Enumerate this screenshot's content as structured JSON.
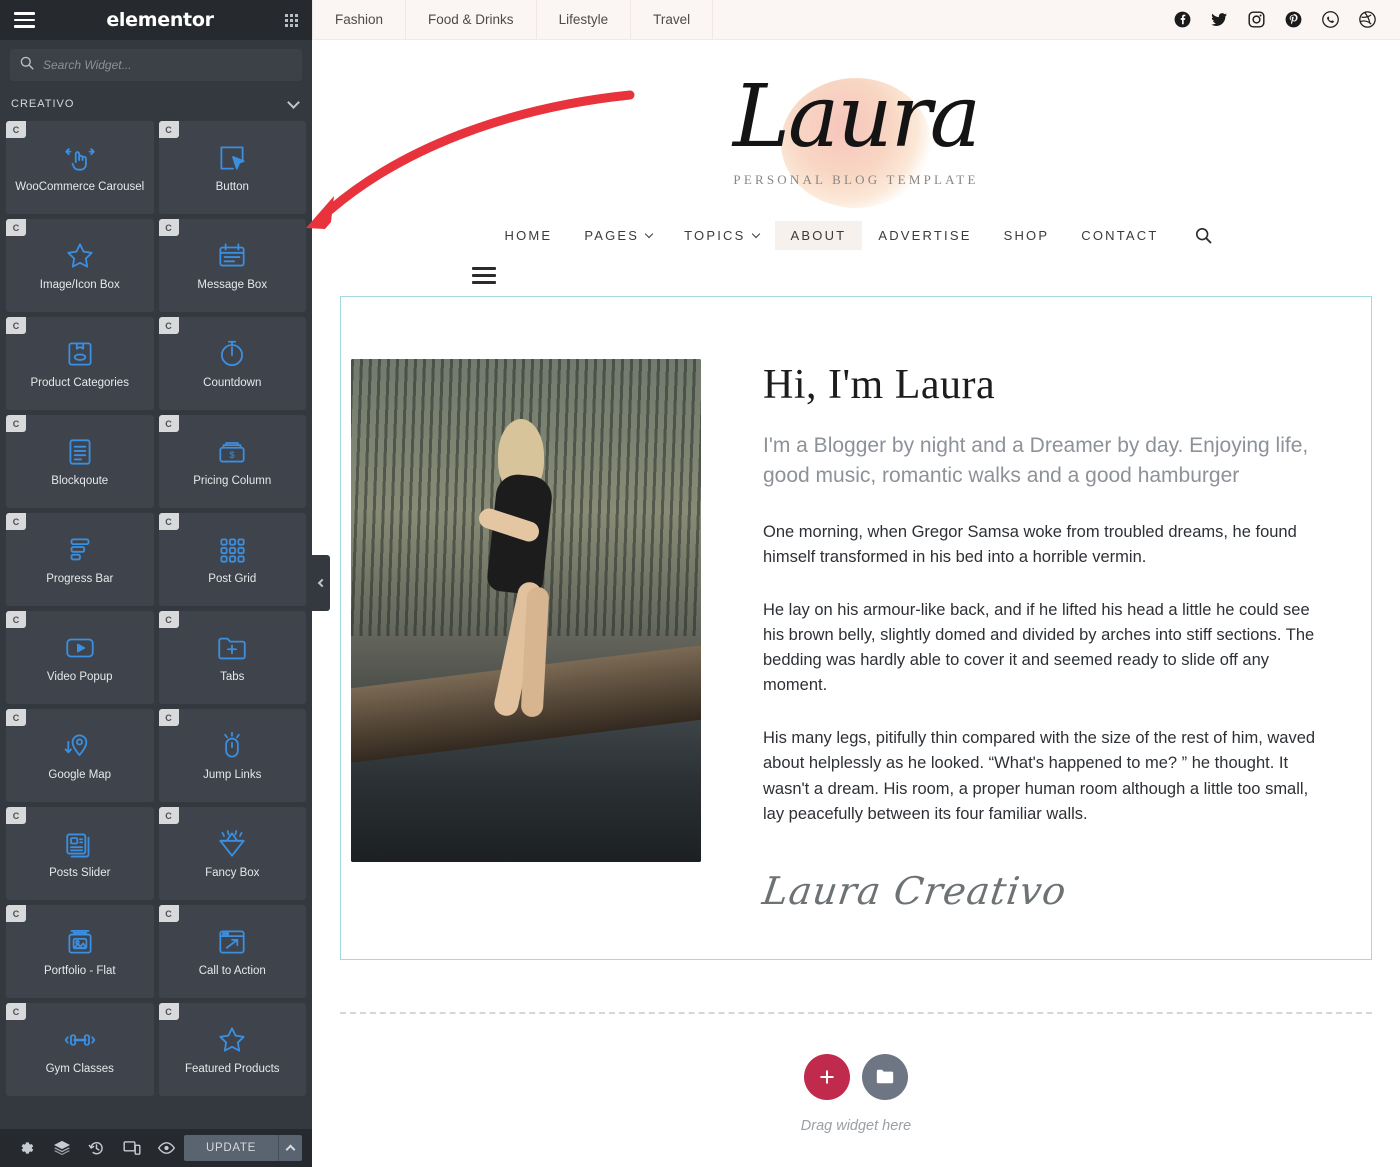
{
  "panel": {
    "brand": "elementor",
    "menu_icon": "hamburger-icon",
    "apps_icon": "grid-apps-icon",
    "search": {
      "placeholder": "Search Widget...",
      "value": "",
      "icon": "search-icon"
    },
    "category": {
      "label": "CREATIVO",
      "chevron": "chevron-down-icon"
    },
    "widget_badge_letter": "C",
    "widgets": [
      {
        "label": "WooCommerce Carousel",
        "icon": "drag-hand-icon"
      },
      {
        "label": "Button",
        "icon": "cursor-click-icon"
      },
      {
        "label": "Image/Icon Box",
        "icon": "star-outline-icon"
      },
      {
        "label": "Message Box",
        "icon": "message-box-icon"
      },
      {
        "label": "Product Categories",
        "icon": "product-box-icon"
      },
      {
        "label": "Countdown",
        "icon": "stopwatch-icon"
      },
      {
        "label": "Blockqoute",
        "icon": "document-lines-icon"
      },
      {
        "label": "Pricing Column",
        "icon": "price-tag-icon"
      },
      {
        "label": "Progress Bar",
        "icon": "progress-bars-icon"
      },
      {
        "label": "Post Grid",
        "icon": "grid-nine-icon"
      },
      {
        "label": "Video Popup",
        "icon": "play-rect-icon"
      },
      {
        "label": "Tabs",
        "icon": "folder-plus-icon"
      },
      {
        "label": "Google Map",
        "icon": "map-pin-arrow-icon"
      },
      {
        "label": "Jump Links",
        "icon": "mouse-click-icon"
      },
      {
        "label": "Posts Slider",
        "icon": "stacked-cards-icon"
      },
      {
        "label": "Fancy Box",
        "icon": "diamond-icon"
      },
      {
        "label": "Portfolio - Flat",
        "icon": "image-stack-icon"
      },
      {
        "label": "Call to Action",
        "icon": "cta-frame-icon"
      },
      {
        "label": "Gym Classes",
        "icon": "dumbbell-icon"
      },
      {
        "label": "Featured Products",
        "icon": "star-outline-icon"
      }
    ],
    "footer": {
      "settings_icon": "gear-icon",
      "navigator_icon": "layers-icon",
      "history_icon": "history-clock-icon",
      "responsive_icon": "responsive-devices-icon",
      "preview_icon": "eye-icon",
      "update_label": "UPDATE",
      "update_caret_icon": "caret-up-icon"
    },
    "collapse_icon": "chevron-left-icon"
  },
  "site": {
    "topbar": {
      "categories": [
        "Fashion",
        "Food & Drinks",
        "Lifestyle",
        "Travel"
      ],
      "socials": [
        "facebook-icon",
        "twitter-icon",
        "instagram-icon",
        "pinterest-icon",
        "whatsapp-icon",
        "dribbble-icon"
      ]
    },
    "logo": {
      "text": "Laura",
      "tagline": "PERSONAL BLOG TEMPLATE"
    },
    "nav": {
      "items": [
        {
          "label": "HOME",
          "dropdown": false,
          "active": false
        },
        {
          "label": "PAGES",
          "dropdown": true,
          "active": false
        },
        {
          "label": "TOPICS",
          "dropdown": true,
          "active": false
        },
        {
          "label": "ABOUT",
          "dropdown": false,
          "active": true
        },
        {
          "label": "ADVERTISE",
          "dropdown": false,
          "active": false
        },
        {
          "label": "SHOP",
          "dropdown": false,
          "active": false
        },
        {
          "label": "CONTACT",
          "dropdown": false,
          "active": false
        }
      ],
      "search_icon": "search-icon",
      "mobile_menu_icon": "hamburger-icon"
    },
    "about": {
      "title": "Hi, I'm Laura",
      "lead": "I'm a Blogger by night and a Dreamer by day. Enjoying life, good music, romantic walks and a good hamburger",
      "paragraphs": [
        "One morning, when Gregor Samsa woke from troubled dreams, he found himself transformed in his bed into a horrible vermin.",
        "He lay on his armour-like back, and if he lifted his head a little he could see his brown belly, slightly domed and divided by arches into stiff sections. The bedding was hardly able to cover it and seemed ready to slide off any moment.",
        "His many legs, pitifully thin compared with the size of the rest of him, waved about helplessly as he looked. “What's happened to me? ” he thought. It wasn't a dream. His room, a proper human room although a little too small, lay peacefully between its four familiar walls."
      ],
      "signature": "Laura Creativo",
      "photo_alt": "woman-sitting-on-tree-branch-photo"
    },
    "drop_zone": {
      "add_section_icon": "plus-icon",
      "template_icon": "folder-icon",
      "hint": "Drag widget here"
    }
  },
  "annotation": {
    "arrow": "red-curved-arrow",
    "color": "#e8323c"
  },
  "colors": {
    "panel_bg": "#34383f",
    "panel_header_bg": "#26292d",
    "widget_bg": "#3f434b",
    "widget_icon": "#3b8fe0",
    "accent_red": "#c02a4c",
    "selection_border": "#a6d8e0",
    "topbar_bg": "#fbf6f4"
  }
}
